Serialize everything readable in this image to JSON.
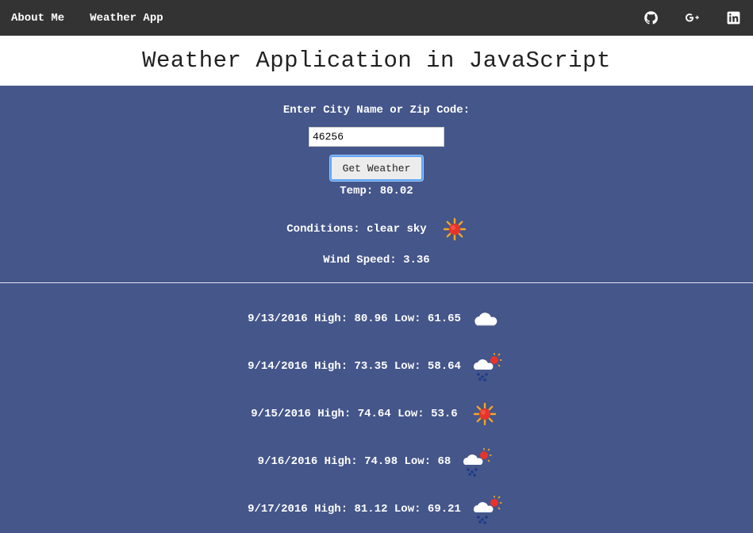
{
  "nav": {
    "links": [
      "About Me",
      "Weather App"
    ],
    "social": [
      "github-icon",
      "google-plus-icon",
      "linkedin-icon"
    ]
  },
  "header": {
    "title": "Weather Application in JavaScript"
  },
  "search": {
    "prompt": "Enter City Name or Zip Code:",
    "value": "46256",
    "button_label": "Get Weather"
  },
  "current": {
    "temp": "Temp: 80.02",
    "conditions": "Conditions: clear sky",
    "conditions_icon": "sun-icon",
    "wind": "Wind Speed: 3.36"
  },
  "forecast": [
    {
      "text": "9/13/2016 High: 80.96 Low: 61.65",
      "icon": "cloud-moon-icon"
    },
    {
      "text": "9/14/2016 High: 73.35 Low: 58.64",
      "icon": "rain-sun-icon"
    },
    {
      "text": "9/15/2016 High: 74.64 Low: 53.6",
      "icon": "sun-icon"
    },
    {
      "text": "9/16/2016 High: 74.98 Low: 68",
      "icon": "rain-sun-icon"
    },
    {
      "text": "9/17/2016 High: 81.12 Low: 69.21",
      "icon": "rain-sun-icon"
    }
  ],
  "colors": {
    "navbar": "#333333",
    "body": "#44568a",
    "sun": "#e8332a",
    "rays": "#f5a623",
    "rain": "#1f3a8a"
  }
}
